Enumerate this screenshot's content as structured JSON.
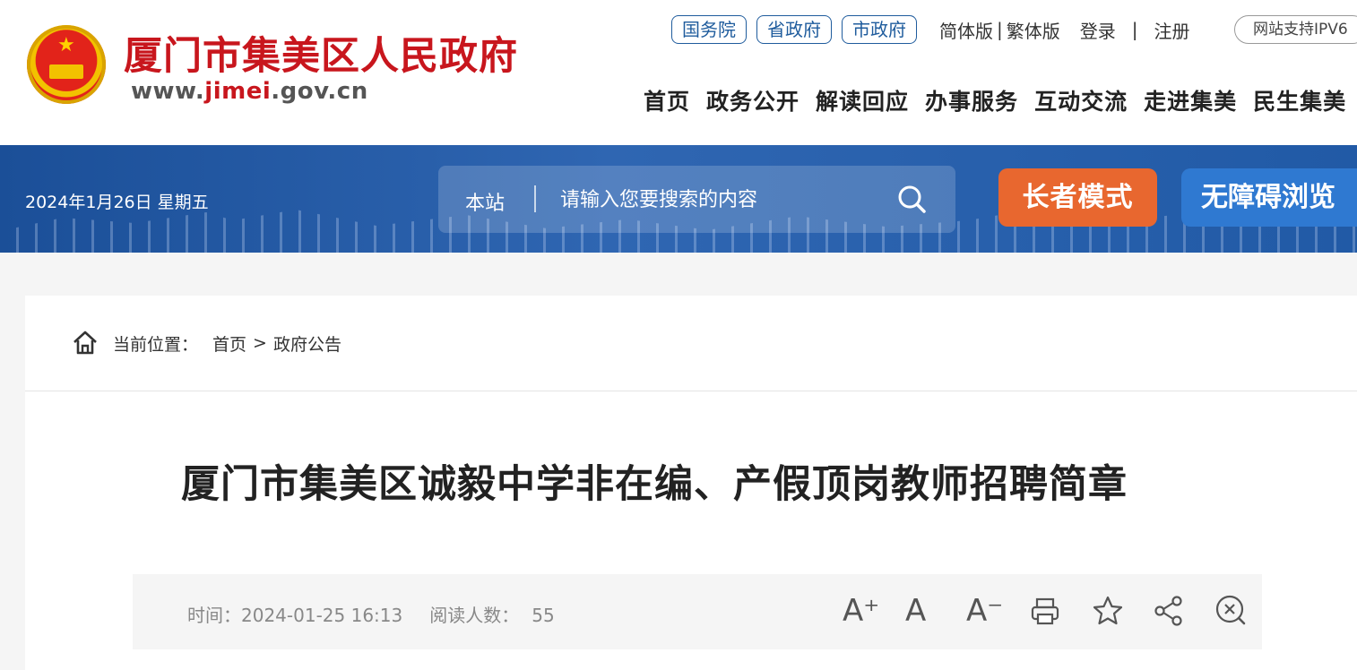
{
  "header": {
    "site_title": "厦门市集美区人民政府",
    "url_prefix": "www.",
    "url_highlight": "jimei",
    "url_suffix": ".gov.cn",
    "gov_links": [
      "国务院",
      "省政府",
      "市政府"
    ],
    "simplified": "简体版",
    "traditional": "繁体版",
    "login": "登录",
    "register": "注册",
    "ipv6": "网站支持IPV6",
    "nav": [
      "首页",
      "政务公开",
      "解读回应",
      "办事服务",
      "互动交流",
      "走进集美",
      "民生集美"
    ]
  },
  "banner": {
    "date": "2024年1月26日 星期五",
    "search_scope": "本站",
    "search_placeholder": "请输入您要搜索的内容",
    "elder_mode": "长者模式",
    "accessible_mode": "无障碍浏览"
  },
  "breadcrumb": {
    "label": "当前位置：",
    "home": "首页",
    "separator": ">",
    "current": "政府公告"
  },
  "article": {
    "title": "厦门市集美区诚毅中学非在编、产假顶岗教师招聘简章",
    "time_label": "时间：",
    "time": "2024-01-25 16:13",
    "reads_label": "阅读人数：",
    "reads": "55"
  },
  "tools": {
    "font_large": "A⁺",
    "font_normal": "A",
    "font_small": "A⁻"
  },
  "colors": {
    "brand_red": "#c8161d",
    "brand_blue": "#1f5c9d",
    "elder_orange": "#e8672f",
    "accessible_blue": "#2f79d1"
  }
}
